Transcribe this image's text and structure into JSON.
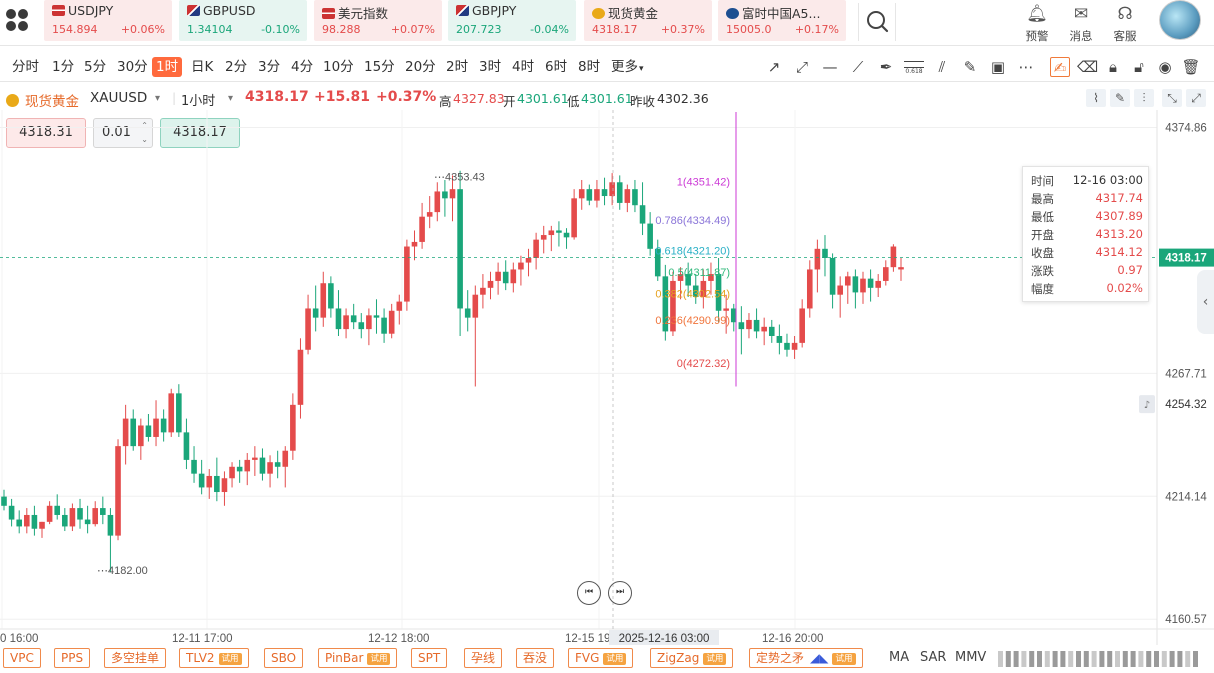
{
  "tickers": [
    {
      "name": "USDJPY",
      "price": "154.894",
      "change": "+0.06%",
      "dir": "up",
      "flag": "us"
    },
    {
      "name": "GBPUSD",
      "price": "1.34104",
      "change": "-0.10%",
      "dir": "down",
      "flag": "uk"
    },
    {
      "name": "美元指数",
      "price": "98.288",
      "change": "+0.07%",
      "dir": "up",
      "flag": "us"
    },
    {
      "name": "GBPJPY",
      "price": "207.723",
      "change": "-0.04%",
      "dir": "down",
      "flag": "uk"
    },
    {
      "name": "现货黄金",
      "price": "4318.17",
      "change": "+0.37%",
      "dir": "up",
      "flag": "gold"
    },
    {
      "name": "富时中国A5...",
      "price": "15005.0",
      "change": "+0.17%",
      "dir": "up",
      "flag": "cn"
    }
  ],
  "top_actions": [
    {
      "label": "预警",
      "icon": "bell-icon"
    },
    {
      "label": "消息",
      "icon": "mail-icon"
    },
    {
      "label": "客服",
      "icon": "headset-icon"
    }
  ],
  "timeframes": [
    "分时",
    "1分",
    "5分",
    "30分",
    "1时",
    "日K",
    "2分",
    "3分",
    "4分",
    "10分",
    "15分",
    "20分",
    "2时",
    "3时",
    "4时",
    "6时",
    "8时",
    "更多"
  ],
  "active_timeframe": "1时",
  "drawing_tools": [
    "ray-line-icon",
    "extended-line-icon",
    "horizontal-line-icon",
    "trend-line-icon",
    "pen-icon",
    "fibonacci-icon",
    "fan-icon",
    "brush-icon",
    "image-icon",
    "more-tools-icon",
    "edit-icon",
    "eraser-icon",
    "lock-icon",
    "unlock-icon",
    "eye-icon",
    "trash-icon"
  ],
  "fib_tool_label": "0.618",
  "symbol": {
    "name": "现货黄金",
    "code": "XAUUSD",
    "interval": "1小时",
    "last": "4318.17",
    "change": "+15.81",
    "change_pct": "+0.37%",
    "high_label": "高",
    "high": "4327.83",
    "open_label": "开",
    "open": "4301.61",
    "low_label": "低",
    "low": "4301.61",
    "prev_close_label": "昨收",
    "prev_close": "4302.36"
  },
  "order": {
    "sell_price": "4318.31",
    "quantity": "0.01",
    "buy_price": "4318.17"
  },
  "tooltip": [
    {
      "key": "时间",
      "value": "12-16 03:00",
      "color": "dark"
    },
    {
      "key": "最高",
      "value": "4317.74",
      "color": "red"
    },
    {
      "key": "最低",
      "value": "4307.89",
      "color": "red"
    },
    {
      "key": "开盘",
      "value": "4313.20",
      "color": "red"
    },
    {
      "key": "收盘",
      "value": "4314.12",
      "color": "red"
    },
    {
      "key": "涨跌",
      "value": "0.97",
      "color": "red"
    },
    {
      "key": "幅度",
      "value": "0.02%",
      "color": "red"
    }
  ],
  "indicators": [
    {
      "label": "VPC",
      "trial": false
    },
    {
      "label": "PPS",
      "trial": false
    },
    {
      "label": "多空挂单",
      "trial": false
    },
    {
      "label": "TLV2",
      "trial": true
    },
    {
      "label": "SBO",
      "trial": false
    },
    {
      "label": "PinBar",
      "trial": true
    },
    {
      "label": "SPT",
      "trial": false
    },
    {
      "label": "孕线",
      "trial": false
    },
    {
      "label": "吞没",
      "trial": false
    },
    {
      "label": "FVG",
      "trial": true
    },
    {
      "label": "ZigZag",
      "trial": true
    },
    {
      "label": "定势之矛",
      "trial": true
    }
  ],
  "trial_label": "试用",
  "main_indicators": [
    "MA",
    "SAR",
    "MMV"
  ],
  "colors": {
    "up": "#e44b4b",
    "down": "#1aa67a",
    "accent": "#ff6a3d",
    "gold": "#e9a918"
  },
  "chart_data": {
    "type": "candlestick",
    "y_ticks": [
      4374.86,
      4267.71,
      4214.14,
      4160.57
    ],
    "y_range": [
      4160.57,
      4374.86
    ],
    "x_ticks": [
      "0 16:00",
      "12-11 17:00",
      "12-12 18:00",
      "12-15 19",
      "12-16 20:00"
    ],
    "crosshair_time": "2025-12-16 03:00",
    "last_price": 4318.17,
    "alert_price": 4254.32,
    "high_marker": "4353.43",
    "low_marker": "4182.00",
    "fibonacci": [
      {
        "ratio": "1",
        "price": "4351.42",
        "color": "#cc3ad6"
      },
      {
        "ratio": "0.786",
        "price": "4334.49",
        "color": "#8a74d8"
      },
      {
        "ratio": "0.618",
        "price": "4321.20",
        "color": "#2ab0c6"
      },
      {
        "ratio": "0.5",
        "price": "4311.87",
        "color": "#2fb87a"
      },
      {
        "ratio": "0.382",
        "price": "4302.54",
        "color": "#e6a21e"
      },
      {
        "ratio": "0.236",
        "price": "4290.99",
        "color": "#f0743b"
      },
      {
        "ratio": "0",
        "price": "4272.32",
        "color": "#e44b4b"
      }
    ],
    "candles": [
      [
        4214,
        4217,
        4208,
        4210
      ],
      [
        4210,
        4213,
        4201,
        4204
      ],
      [
        4204,
        4208,
        4198,
        4201
      ],
      [
        4201,
        4209,
        4198,
        4206
      ],
      [
        4206,
        4210,
        4197,
        4200
      ],
      [
        4200,
        4203,
        4196,
        4203
      ],
      [
        4203,
        4212,
        4202,
        4210
      ],
      [
        4210,
        4215,
        4204,
        4206
      ],
      [
        4206,
        4209,
        4199,
        4201
      ],
      [
        4201,
        4211,
        4199,
        4209
      ],
      [
        4209,
        4213,
        4200,
        4204
      ],
      [
        4204,
        4210,
        4198,
        4202
      ],
      [
        4202,
        4212,
        4201,
        4209
      ],
      [
        4209,
        4214,
        4202,
        4206
      ],
      [
        4206,
        4209,
        4181,
        4197
      ],
      [
        4197,
        4239,
        4195,
        4236
      ],
      [
        4236,
        4254,
        4228,
        4248
      ],
      [
        4248,
        4252,
        4234,
        4236
      ],
      [
        4236,
        4248,
        4230,
        4245
      ],
      [
        4245,
        4250,
        4238,
        4240
      ],
      [
        4240,
        4256,
        4236,
        4248
      ],
      [
        4248,
        4252,
        4238,
        4242
      ],
      [
        4242,
        4261,
        4240,
        4259
      ],
      [
        4259,
        4263,
        4240,
        4242
      ],
      [
        4242,
        4248,
        4226,
        4230
      ],
      [
        4230,
        4236,
        4220,
        4224
      ],
      [
        4224,
        4230,
        4215,
        4218
      ],
      [
        4218,
        4226,
        4213,
        4223
      ],
      [
        4223,
        4231,
        4212,
        4216
      ],
      [
        4216,
        4225,
        4210,
        4222
      ],
      [
        4222,
        4229,
        4218,
        4227
      ],
      [
        4227,
        4230,
        4220,
        4225
      ],
      [
        4225,
        4233,
        4219,
        4230
      ],
      [
        4230,
        4236,
        4223,
        4231
      ],
      [
        4231,
        4235,
        4221,
        4224
      ],
      [
        4224,
        4232,
        4218,
        4229
      ],
      [
        4229,
        4234,
        4222,
        4227
      ],
      [
        4227,
        4236,
        4218,
        4234
      ],
      [
        4234,
        4259,
        4230,
        4254
      ],
      [
        4254,
        4283,
        4248,
        4278
      ],
      [
        4278,
        4302,
        4276,
        4296
      ],
      [
        4296,
        4306,
        4286,
        4292
      ],
      [
        4292,
        4312,
        4288,
        4307
      ],
      [
        4307,
        4310,
        4292,
        4296
      ],
      [
        4296,
        4304,
        4284,
        4287
      ],
      [
        4287,
        4296,
        4283,
        4293
      ],
      [
        4293,
        4298,
        4287,
        4290
      ],
      [
        4290,
        4294,
        4283,
        4287
      ],
      [
        4287,
        4296,
        4280,
        4293
      ],
      [
        4293,
        4300,
        4285,
        4292
      ],
      [
        4292,
        4296,
        4281,
        4285
      ],
      [
        4285,
        4298,
        4283,
        4295
      ],
      [
        4295,
        4302,
        4289,
        4299
      ],
      [
        4299,
        4326,
        4295,
        4323
      ],
      [
        4323,
        4330,
        4317,
        4325
      ],
      [
        4325,
        4342,
        4322,
        4336
      ],
      [
        4336,
        4345,
        4331,
        4338
      ],
      [
        4338,
        4351,
        4334,
        4347
      ],
      [
        4347,
        4352,
        4336,
        4344
      ],
      [
        4344,
        4354,
        4334,
        4348
      ],
      [
        4348,
        4356,
        4284,
        4296
      ],
      [
        4296,
        4304,
        4286,
        4292
      ],
      [
        4292,
        4306,
        4262,
        4302
      ],
      [
        4302,
        4311,
        4296,
        4305
      ],
      [
        4305,
        4312,
        4300,
        4308
      ],
      [
        4308,
        4316,
        4302,
        4312
      ],
      [
        4312,
        4317,
        4304,
        4307
      ],
      [
        4307,
        4316,
        4303,
        4313
      ],
      [
        4313,
        4319,
        4306,
        4316
      ],
      [
        4316,
        4322,
        4310,
        4318
      ],
      [
        4318,
        4329,
        4313,
        4326
      ],
      [
        4326,
        4332,
        4320,
        4328
      ],
      [
        4328,
        4332,
        4321,
        4330
      ],
      [
        4330,
        4334,
        4323,
        4329
      ],
      [
        4329,
        4331,
        4322,
        4327
      ],
      [
        4327,
        4348,
        4326,
        4344
      ],
      [
        4344,
        4352,
        4339,
        4348
      ],
      [
        4348,
        4350,
        4341,
        4343
      ],
      [
        4343,
        4352,
        4340,
        4348
      ],
      [
        4348,
        4353,
        4341,
        4345
      ],
      [
        4345,
        4355,
        4341,
        4351
      ],
      [
        4351,
        4354,
        4339,
        4342
      ],
      [
        4342,
        4350,
        4338,
        4348
      ],
      [
        4348,
        4352,
        4338,
        4341
      ],
      [
        4341,
        4351,
        4328,
        4333
      ],
      [
        4333,
        4338,
        4319,
        4322
      ],
      [
        4322,
        4326,
        4308,
        4310
      ],
      [
        4310,
        4315,
        4282,
        4286
      ],
      [
        4286,
        4312,
        4284,
        4308
      ],
      [
        4308,
        4314,
        4300,
        4311
      ],
      [
        4311,
        4316,
        4301,
        4306
      ],
      [
        4306,
        4311,
        4298,
        4301
      ],
      [
        4301,
        4313,
        4296,
        4308
      ],
      [
        4308,
        4316,
        4302,
        4311
      ],
      [
        4311,
        4318,
        4290,
        4295
      ],
      [
        4295,
        4302,
        4285,
        4296
      ],
      [
        4296,
        4298,
        4286,
        4290
      ],
      [
        4290,
        4297,
        4276,
        4287
      ],
      [
        4287,
        4294,
        4283,
        4291
      ],
      [
        4291,
        4296,
        4283,
        4286
      ],
      [
        4286,
        4292,
        4280,
        4288
      ],
      [
        4288,
        4291,
        4281,
        4284
      ],
      [
        4284,
        4289,
        4276,
        4281
      ],
      [
        4281,
        4285,
        4275,
        4278
      ],
      [
        4278,
        4284,
        4274,
        4281
      ],
      [
        4281,
        4300,
        4279,
        4296
      ],
      [
        4296,
        4317,
        4292,
        4313
      ],
      [
        4313,
        4326,
        4303,
        4322
      ],
      [
        4322,
        4328,
        4310,
        4318
      ],
      [
        4318,
        4320,
        4296,
        4302
      ],
      [
        4302,
        4310,
        4292,
        4306
      ],
      [
        4306,
        4312,
        4298,
        4310
      ],
      [
        4310,
        4313,
        4296,
        4303
      ],
      [
        4303,
        4312,
        4298,
        4309
      ],
      [
        4309,
        4313,
        4299,
        4305
      ],
      [
        4305,
        4311,
        4301,
        4308
      ],
      [
        4308,
        4317,
        4306,
        4314
      ],
      [
        4314,
        4324,
        4312,
        4323
      ],
      [
        4313,
        4318,
        4308,
        4314
      ]
    ]
  }
}
